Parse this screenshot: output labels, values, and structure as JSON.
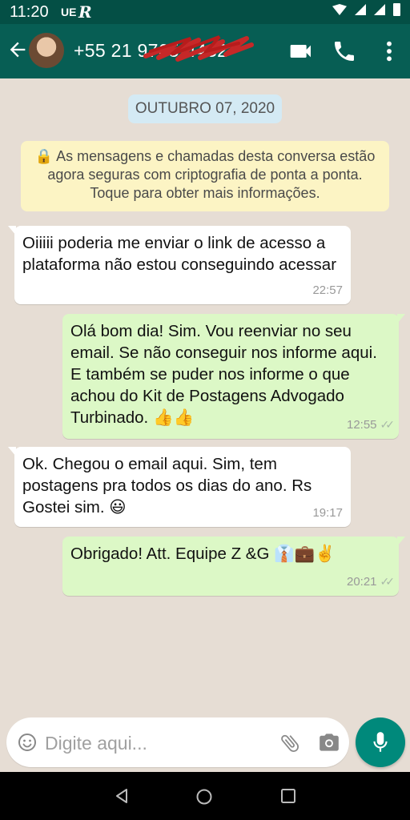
{
  "status_bar": {
    "time": "11:20",
    "carrier": "UE",
    "r_icon": "R"
  },
  "header": {
    "contact_name": "+55 21 9765-4432",
    "icons": [
      "back-arrow-icon",
      "avatar",
      "video-call-icon",
      "voice-call-icon",
      "overflow-menu-icon"
    ]
  },
  "chat": {
    "date_chip": "OUTUBRO 07, 2020",
    "system_message": "🔒 As mensagens e chamadas desta conversa estão agora seguras com criptografia de ponta a ponta. Toque para obter mais informações.",
    "messages": [
      {
        "direction": "in",
        "text": "Oiiiii poderia me enviar o link de acesso a plataforma não estou conseguindo acessar",
        "time": "22:57"
      },
      {
        "direction": "out",
        "text": "Olá bom dia! Sim. Vou reenviar no seu email. Se não conseguir nos informe aqui. E também se puder nos informe o que achou do Kit de Postagens Advogado Turbinado. 👍👍",
        "time": "12:55",
        "status": "read"
      },
      {
        "direction": "in",
        "text": "Ok. Chegou o email aqui. Sim, tem postagens pra todos os dias do ano. Rs Gostei sim. 😃",
        "time": "19:17"
      },
      {
        "direction": "out",
        "text": "Obrigado! Att. Equipe Z &G 👔💼✌️",
        "time": "20:21",
        "status": "read"
      }
    ]
  },
  "composer": {
    "placeholder": "Digite aqui..."
  },
  "colors": {
    "header": "#075e54",
    "status_bar": "#044f45",
    "incoming_bubble": "#ffffff",
    "outgoing_bubble": "#dcf8c6",
    "system_bubble": "#fcf4c4",
    "date_chip": "#d4eaf4",
    "mic_button": "#00897b",
    "chat_background": "#e6ddd4"
  }
}
